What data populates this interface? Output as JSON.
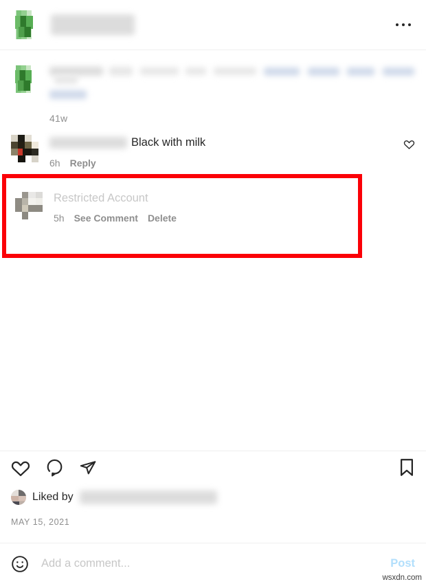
{
  "post": {
    "header": {
      "username_redacted": true,
      "menu_label": "More options"
    },
    "caption": {
      "timestamp": "41w"
    },
    "comments": [
      {
        "username_redacted": true,
        "text": "Black with milk",
        "timestamp": "6h",
        "reply_label": "Reply",
        "like_icon": "heart-icon"
      }
    ],
    "restricted_comment": {
      "title": "Restricted Account",
      "timestamp": "5h",
      "see_comment_label": "See Comment",
      "delete_label": "Delete",
      "highlight_color": "#fb0007"
    },
    "actions": {
      "like_icon": "heart-icon",
      "comment_icon": "speech-bubble-icon",
      "share_icon": "paper-plane-icon",
      "save_icon": "bookmark-icon"
    },
    "likes": {
      "prefix": "Liked by",
      "names_redacted": true
    },
    "date": "MAY 15, 2021",
    "composer": {
      "emoji_icon": "smiley-face-icon",
      "placeholder": "Add a comment...",
      "value": "",
      "post_label": "Post",
      "post_color": "#b2dffc"
    }
  },
  "watermark": "wsxdn.com"
}
